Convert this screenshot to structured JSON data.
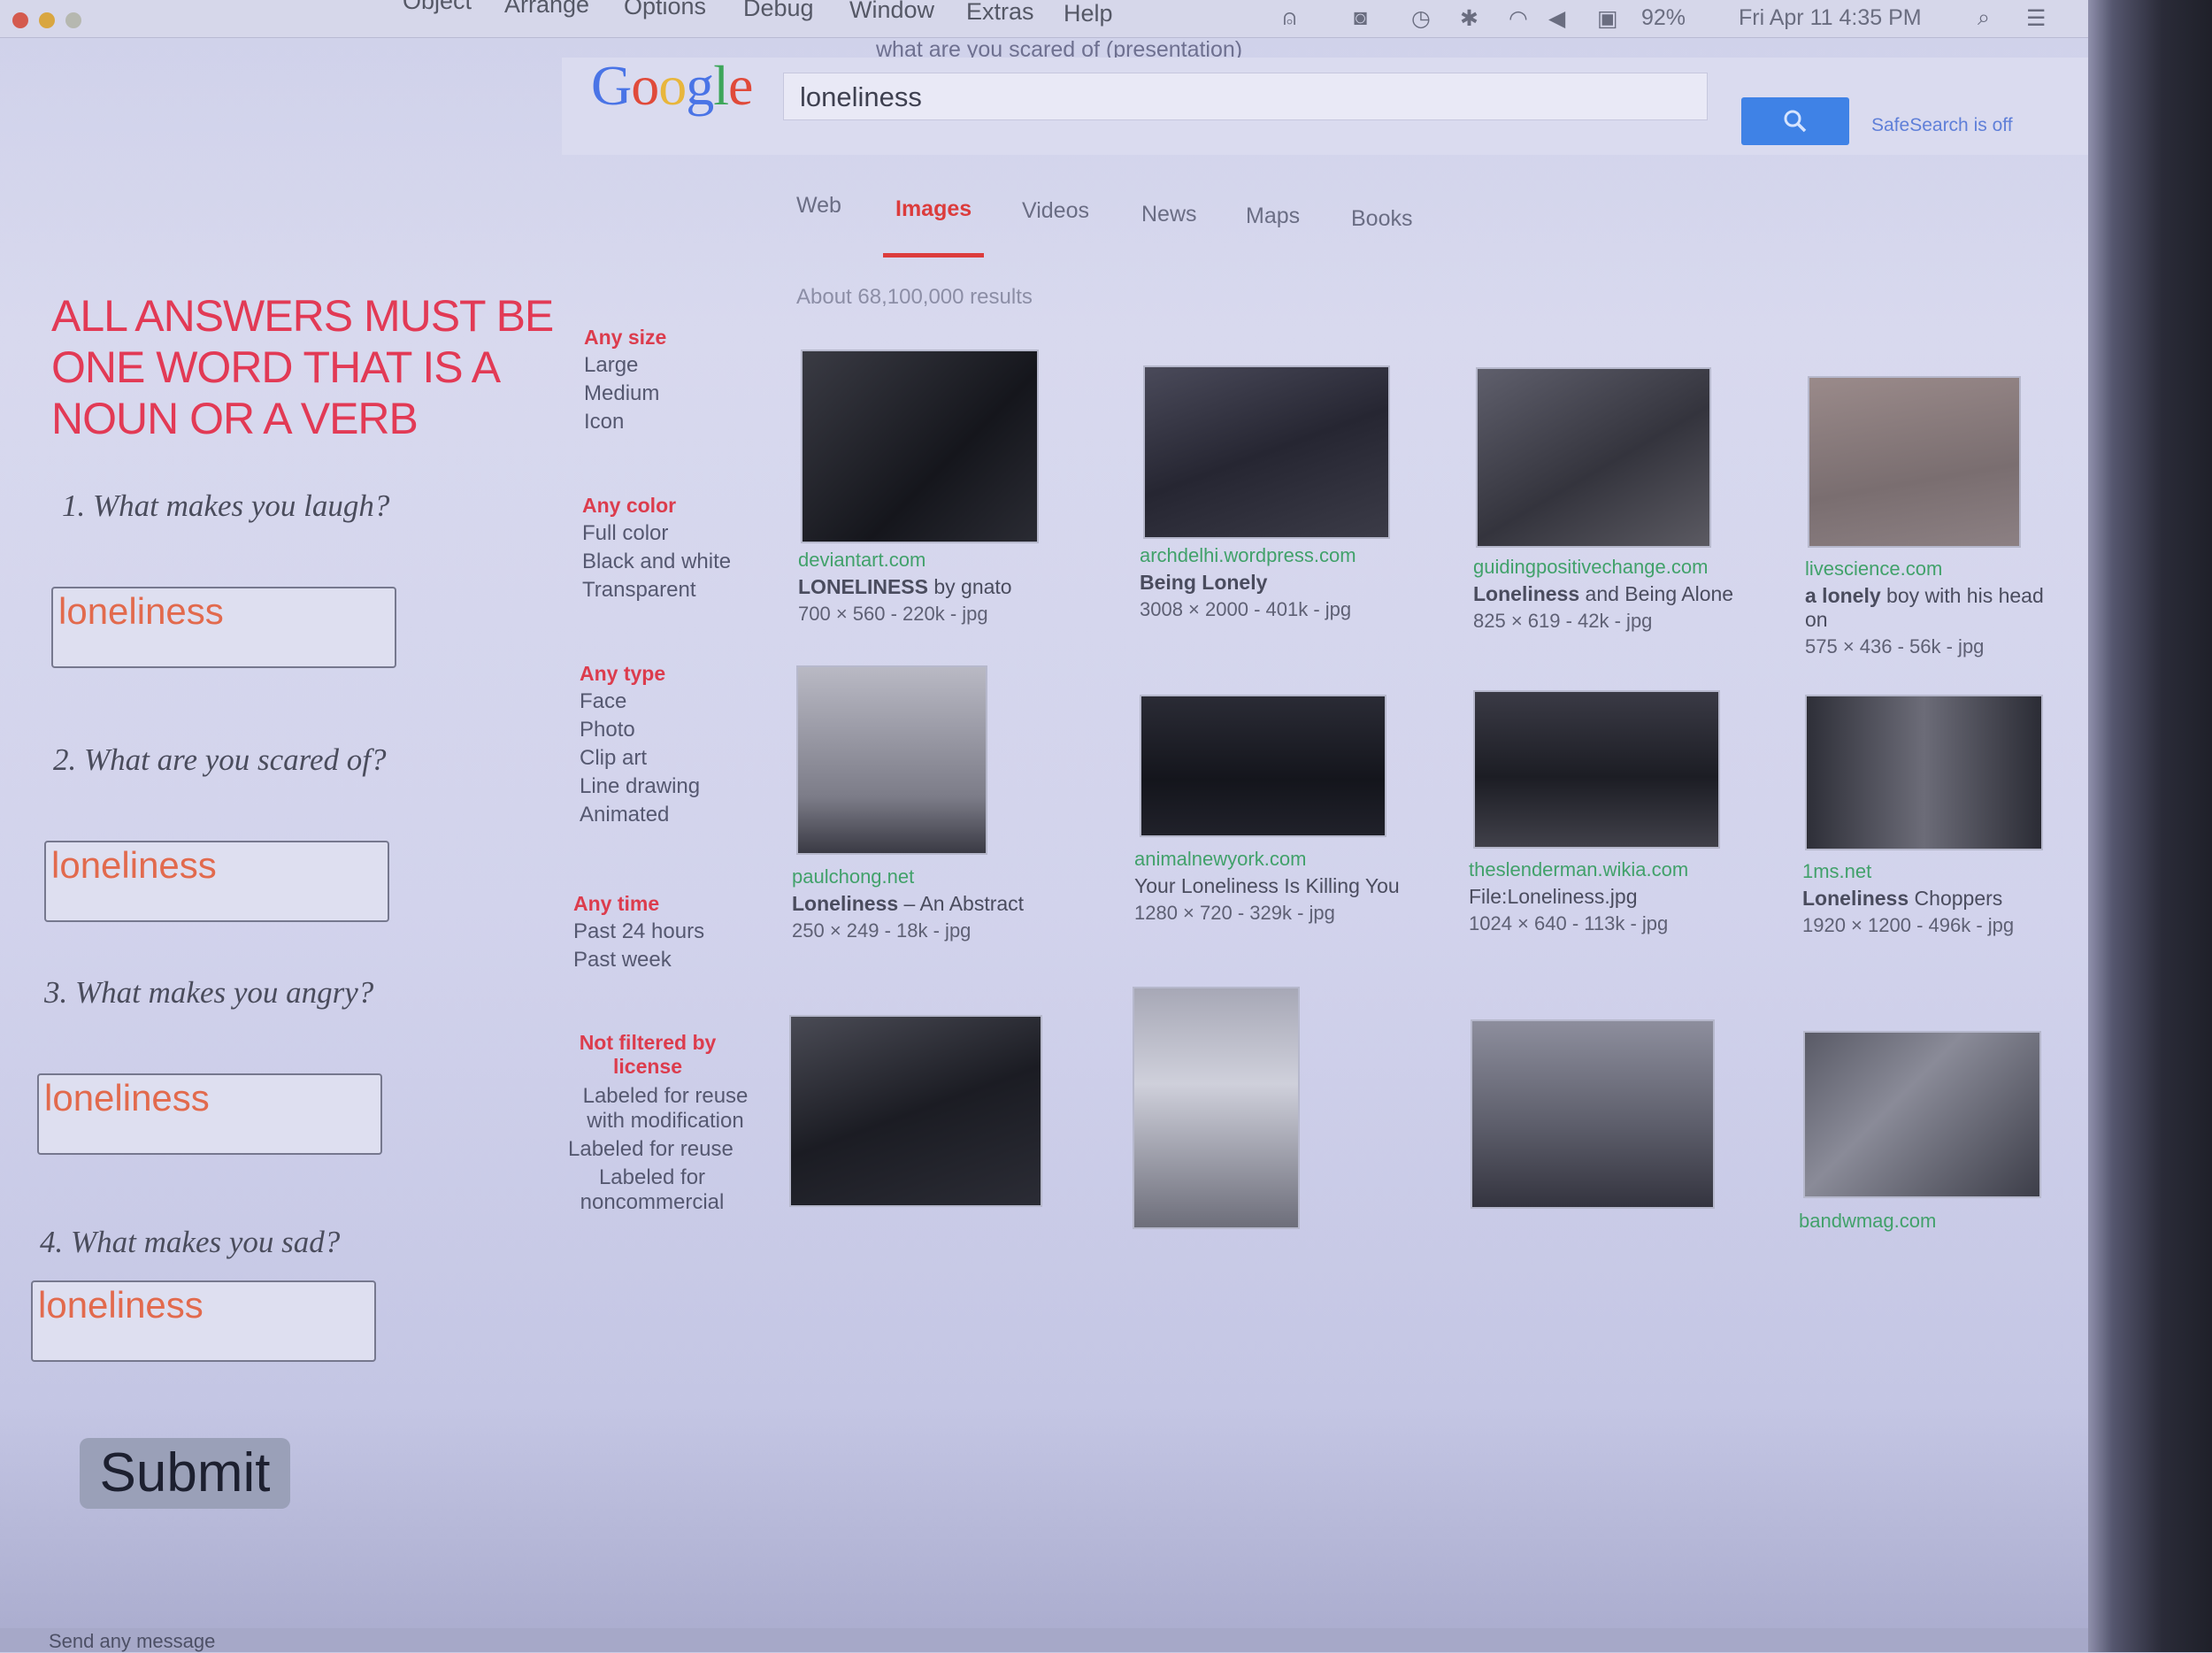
{
  "menubar": {
    "items": [
      "Object",
      "Arrange",
      "Options",
      "Debug",
      "Window",
      "Extras",
      "Help"
    ],
    "status_battery": "92%",
    "status_datetime": "Fri Apr 11 4:35 PM"
  },
  "window": {
    "title": "what are you scared of (presentation)"
  },
  "google": {
    "logo": [
      "G",
      "o",
      "o",
      "g",
      "l",
      "e"
    ],
    "logo_colors": [
      "#4a74e6",
      "#e04a3a",
      "#e8b63c",
      "#4a74e6",
      "#3da65a",
      "#e04a3a"
    ],
    "query": "loneliness",
    "safesearch": "SafeSearch is off",
    "tabs": [
      "Web",
      "Images",
      "Videos",
      "News",
      "Maps",
      "Books"
    ],
    "active_tab": "Images",
    "results_count": "About 68,100,000 results"
  },
  "form": {
    "instructions": "ALL ANSWERS MUST BE ONE WORD THAT IS A NOUN OR A VERB",
    "questions": [
      {
        "label": "1. What makes you laugh?",
        "answer": "loneliness"
      },
      {
        "label": "2. What are you scared of?",
        "answer": "loneliness"
      },
      {
        "label": "3. What makes you angry?",
        "answer": "loneliness"
      },
      {
        "label": "4. What makes you sad?",
        "answer": "loneliness"
      }
    ],
    "submit": "Submit"
  },
  "filters": {
    "size": {
      "heading": "Any size",
      "options": [
        "Large",
        "Medium",
        "Icon"
      ]
    },
    "color": {
      "heading": "Any color",
      "options": [
        "Full color",
        "Black and white",
        "Transparent"
      ]
    },
    "type": {
      "heading": "Any type",
      "options": [
        "Face",
        "Photo",
        "Clip art",
        "Line drawing",
        "Animated"
      ]
    },
    "time": {
      "heading": "Any time",
      "options": [
        "Past 24 hours",
        "Past week"
      ]
    },
    "license": {
      "heading": "Not filtered by license",
      "options": [
        "Labeled for reuse with modification",
        "Labeled for reuse",
        "Labeled for noncommercial"
      ]
    }
  },
  "results": [
    {
      "site": "deviantart.com",
      "title_bold": "LONELINESS",
      "title_rest": " by gnato",
      "dims": "700 × 560 - 220k - jpg"
    },
    {
      "site": "archdelhi.wordpress.com",
      "title_bold": "",
      "title_rest": "Being Lonely",
      "dims": "3008 × 2000 - 401k - jpg"
    },
    {
      "site": "guidingpositivechange.com",
      "title_bold": "Loneliness",
      "title_rest": " and Being Alone",
      "dims": "825 × 619 - 42k - jpg"
    },
    {
      "site": "livescience.com",
      "title_bold": "a lonely",
      "title_rest": " boy with his head on",
      "dims": "575 × 436 - 56k - jpg"
    },
    {
      "site": "paulchong.net",
      "title_bold": "Loneliness",
      "title_rest": " – An Abstract",
      "dims": "250 × 249 - 18k - jpg"
    },
    {
      "site": "animalnewyork.com",
      "title_bold": "",
      "title_rest": "Your Loneliness Is Killing You",
      "dims": "1280 × 720 - 329k - jpg"
    },
    {
      "site": "theslenderman.wikia.com",
      "title_bold": "",
      "title_rest": "File:Loneliness.jpg",
      "dims": "1024 × 640 - 113k - jpg"
    },
    {
      "site": "1ms.net",
      "title_bold": "Loneliness",
      "title_rest": " Choppers",
      "dims": "1920 × 1200 - 496k - jpg"
    },
    {
      "site": "bandwmag.com"
    }
  ],
  "bottom": {
    "message": "Send any message"
  }
}
